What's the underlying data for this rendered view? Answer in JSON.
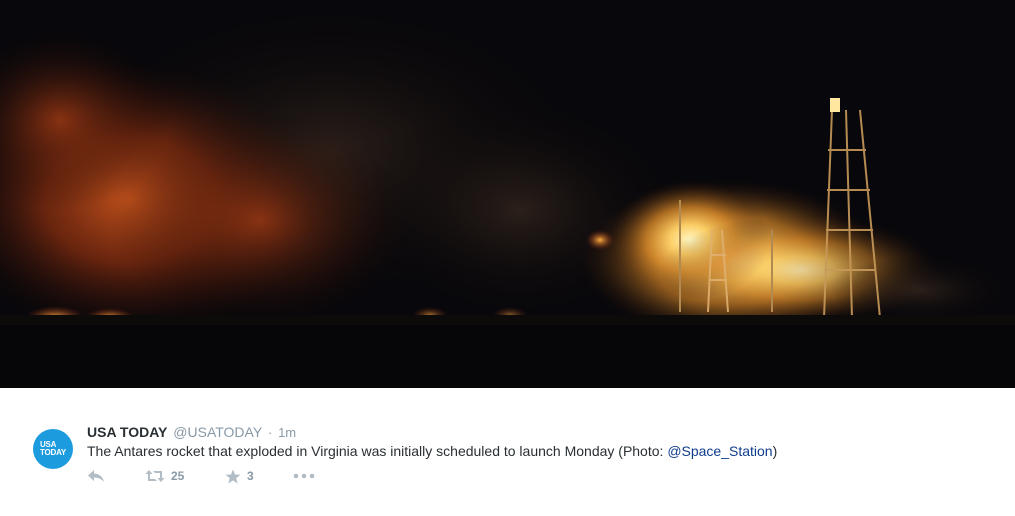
{
  "media": {
    "description_icon": "photo-rocket-explosion"
  },
  "tweet": {
    "author_name": "USA TODAY",
    "author_handle": "@USATODAY",
    "separator": "·",
    "timestamp": "1m",
    "avatar": {
      "line1": "USA",
      "line2": "TODAY",
      "color": "#1d9bdf"
    },
    "text_before": "The Antares rocket that exploded in Virginia was initially scheduled to launch Monday (Photo: ",
    "mention": "@Space_Station",
    "text_after": ")"
  },
  "actions": {
    "reply_icon": "reply-icon",
    "retweet_icon": "retweet-icon",
    "retweet_count": "25",
    "favorite_icon": "star-icon",
    "favorite_count": "3",
    "more_icon": "more-icon"
  },
  "colors": {
    "mention": "#0f3d8c",
    "muted": "#8899a6",
    "icon": "#a4b0ba"
  }
}
